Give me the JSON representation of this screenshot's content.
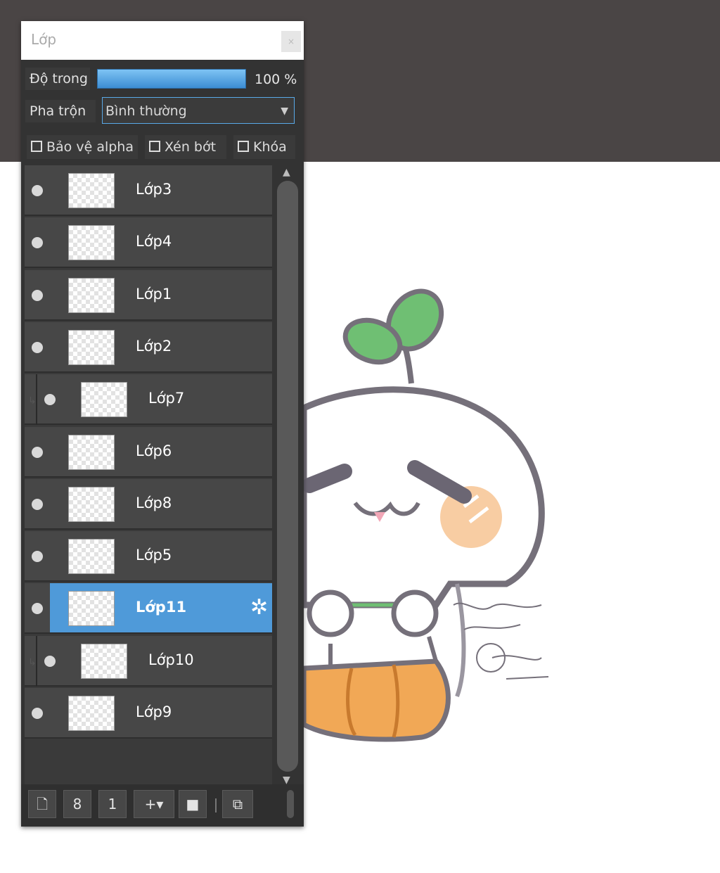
{
  "panel": {
    "title": "Lớp",
    "close_label": "×",
    "opacity": {
      "label": "Độ trong",
      "value": "100 %",
      "level_percent": 100
    },
    "blend": {
      "label": "Pha trộn",
      "value": "Bình thường"
    },
    "checks": [
      {
        "label": "Bảo vệ alpha",
        "checked": false
      },
      {
        "label": "Xén bớt",
        "checked": false
      },
      {
        "label": "Khóa",
        "checked": false
      }
    ],
    "layers": [
      {
        "name": "Lớp3",
        "visible": true,
        "clipped": false,
        "selected": false
      },
      {
        "name": "Lớp4",
        "visible": true,
        "clipped": false,
        "selected": false
      },
      {
        "name": "Lớp1",
        "visible": true,
        "clipped": false,
        "selected": false
      },
      {
        "name": "Lớp2",
        "visible": true,
        "clipped": false,
        "selected": false
      },
      {
        "name": "Lớp7",
        "visible": true,
        "clipped": true,
        "selected": false
      },
      {
        "name": "Lớp6",
        "visible": true,
        "clipped": false,
        "selected": false
      },
      {
        "name": "Lớp8",
        "visible": true,
        "clipped": false,
        "selected": false
      },
      {
        "name": "Lớp5",
        "visible": true,
        "clipped": false,
        "selected": false
      },
      {
        "name": "Lớp11",
        "visible": true,
        "clipped": false,
        "selected": true
      },
      {
        "name": "Lớp10",
        "visible": true,
        "clipped": true,
        "selected": false
      },
      {
        "name": "Lớp9",
        "visible": true,
        "clipped": false,
        "selected": false
      }
    ],
    "toolbar": [
      {
        "name": "new-layer-icon",
        "glyph": "🗋"
      },
      {
        "name": "new-8bit-layer-icon",
        "glyph": "8"
      },
      {
        "name": "new-1bit-layer-icon",
        "glyph": "1"
      },
      {
        "name": "add-layer-menu-icon",
        "glyph": "+▾"
      },
      {
        "name": "folder-icon",
        "glyph": "■"
      },
      {
        "name": "duplicate-layer-icon",
        "glyph": "⧉"
      }
    ]
  },
  "colors": {
    "accent": "#4f9ad9",
    "panel_bg": "#333333",
    "top_band": "#4a4545"
  }
}
